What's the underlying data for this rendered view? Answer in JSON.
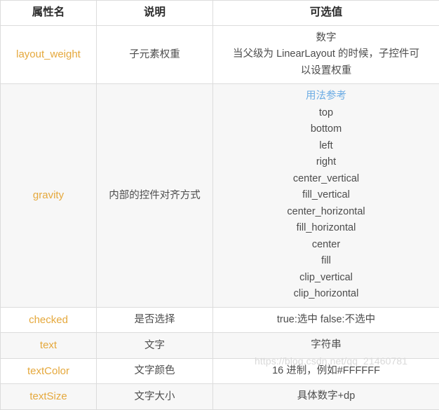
{
  "table": {
    "headers": [
      "属性名",
      "说明",
      "可选值"
    ],
    "rows": [
      {
        "name": "layout_weight",
        "desc": "子元素权重",
        "value_lines": [
          "数字",
          "当父级为 LinearLayout 的时候，子控件可",
          "以设置权重"
        ],
        "shaded": false
      },
      {
        "name": "gravity",
        "desc": "内部的控件对齐方式",
        "value_lines": [
          "用法参考",
          "top",
          "bottom",
          "left",
          "right",
          "center_vertical",
          "fill_vertical",
          "center_horizontal",
          "fill_horizontal",
          "center",
          "fill",
          "clip_vertical",
          "clip_horizontal"
        ],
        "link_line_index": 0,
        "shaded": true
      },
      {
        "name": "checked",
        "desc": "是否选择",
        "value_lines": [
          "true:选中 false:不选中"
        ],
        "shaded": false
      },
      {
        "name": "text",
        "desc": "文字",
        "value_lines": [
          "字符串"
        ],
        "shaded": true
      },
      {
        "name": "textColor",
        "desc": "文字颜色",
        "value_lines": [
          "16 进制，例如#FFFFFF"
        ],
        "shaded": false
      },
      {
        "name": "textSize",
        "desc": "文字大小",
        "value_lines": [
          "具体数字+dp"
        ],
        "shaded": true
      }
    ]
  },
  "watermark": {
    "text": "https://blog.csdn.net/qq_21460781"
  },
  "colors": {
    "attr_name": "#E5A83C",
    "link": "#6CACE4",
    "text": "#4C4C4C",
    "header_text": "#2B2B2B",
    "border": "#DCDCDC",
    "row_shaded": "#F7F7F7",
    "row_plain": "#FFFFFF",
    "watermark": "#D9D9D9"
  }
}
